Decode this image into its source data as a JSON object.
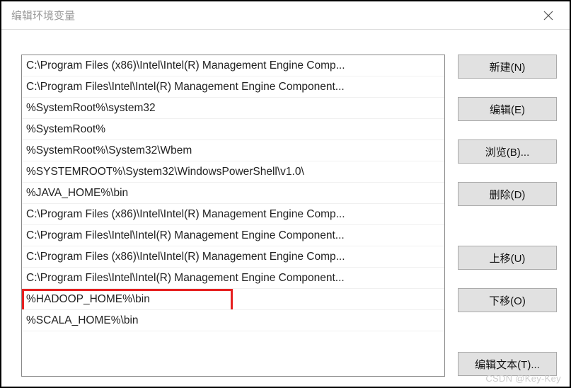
{
  "window": {
    "title": "编辑环境变量"
  },
  "list": {
    "items": [
      "C:\\Program Files (x86)\\Intel\\Intel(R) Management Engine Comp...",
      "C:\\Program Files\\Intel\\Intel(R) Management Engine Component...",
      "%SystemRoot%\\system32",
      "%SystemRoot%",
      "%SystemRoot%\\System32\\Wbem",
      "%SYSTEMROOT%\\System32\\WindowsPowerShell\\v1.0\\",
      "%JAVA_HOME%\\bin",
      "C:\\Program Files (x86)\\Intel\\Intel(R) Management Engine Comp...",
      "C:\\Program Files\\Intel\\Intel(R) Management Engine Component...",
      "C:\\Program Files (x86)\\Intel\\Intel(R) Management Engine Comp...",
      "C:\\Program Files\\Intel\\Intel(R) Management Engine Component...",
      "%HADOOP_HOME%\\bin",
      "%SCALA_HOME%\\bin"
    ],
    "highlighted_index": 11
  },
  "buttons": {
    "new": "新建(N)",
    "edit": "编辑(E)",
    "browse": "浏览(B)...",
    "delete": "删除(D)",
    "move_up": "上移(U)",
    "move_down": "下移(O)",
    "edit_text": "编辑文本(T)..."
  },
  "watermark": "CSDN @Key-Key"
}
